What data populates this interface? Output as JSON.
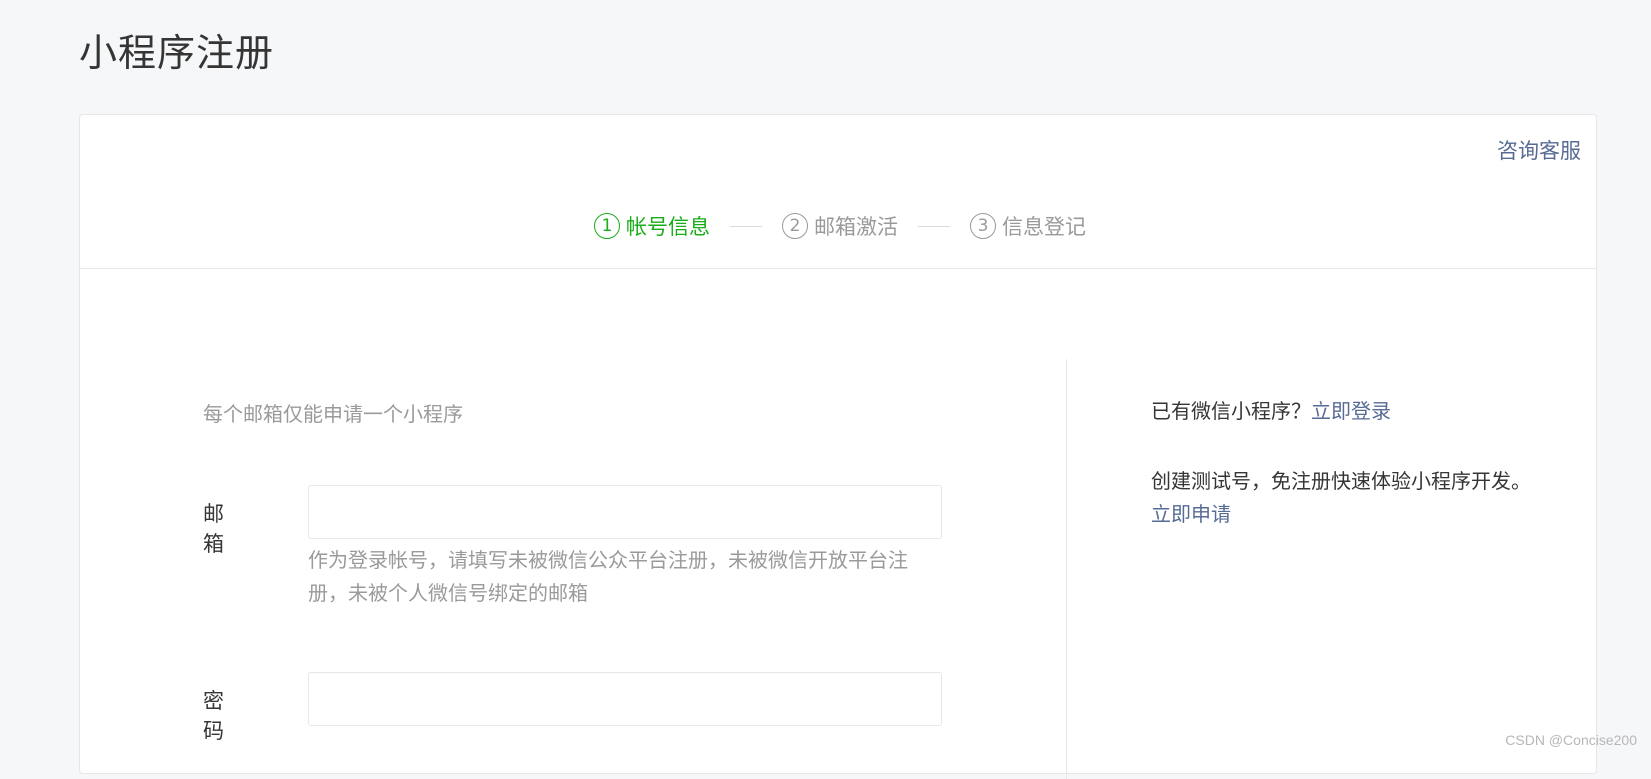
{
  "page": {
    "title": "小程序注册"
  },
  "help": {
    "label": "咨询客服"
  },
  "steps": [
    {
      "num": "1",
      "label": "帐号信息",
      "active": true
    },
    {
      "num": "2",
      "label": "邮箱激活",
      "active": false
    },
    {
      "num": "3",
      "label": "信息登记",
      "active": false
    }
  ],
  "form": {
    "tip": "每个邮箱仅能申请一个小程序",
    "email": {
      "label": "邮箱",
      "value": "",
      "placeholder": "",
      "desc": "作为登录帐号，请填写未被微信公众平台注册，未被微信开放平台注册，未被个人微信号绑定的邮箱"
    },
    "password": {
      "label": "密码",
      "value": "",
      "placeholder": ""
    }
  },
  "side": {
    "login_prompt": "已有微信小程序？",
    "login_link": "立即登录",
    "test_prompt": "创建测试号，免注册快速体验小程序开发。",
    "test_link": "立即申请"
  },
  "watermark": "CSDN @Concise200",
  "colors": {
    "accent_green": "#1aad19",
    "link_blue": "#576b95",
    "muted": "#9a9a9a",
    "background": "#f6f7f9"
  }
}
